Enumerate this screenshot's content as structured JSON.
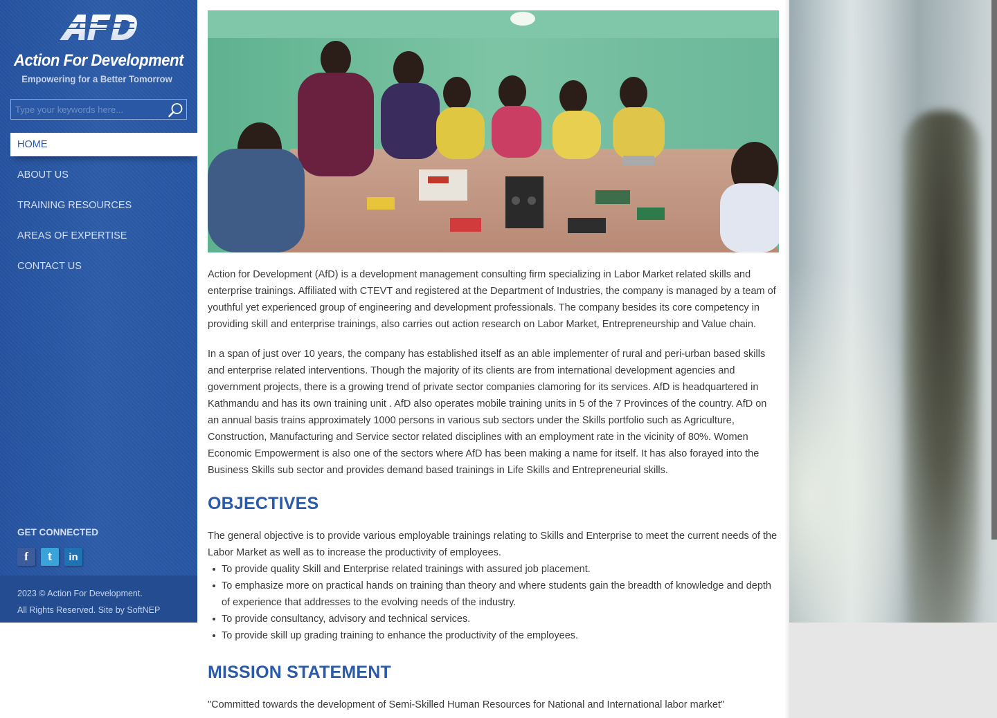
{
  "brand": {
    "logo_text": "AFD",
    "title": "Action For Development",
    "tagline": "Empowering for a Better Tomorrow"
  },
  "search": {
    "placeholder": "Type your keywords here...",
    "icon": "search-icon"
  },
  "nav": {
    "items": [
      {
        "label": "HOME",
        "active": true
      },
      {
        "label": "ABOUT US",
        "active": false
      },
      {
        "label": "TRAINING RESOURCES",
        "active": false
      },
      {
        "label": "AREAS OF EXPERTISE",
        "active": false
      },
      {
        "label": "CONTACT US",
        "active": false
      }
    ]
  },
  "connect": {
    "title": "GET CONNECTED",
    "socials": [
      {
        "name": "facebook",
        "glyph": "f",
        "icon": "facebook-icon",
        "color": "#3b5b9a"
      },
      {
        "name": "twitter",
        "glyph": "t",
        "icon": "twitter-icon",
        "color": "#3aa3d9"
      },
      {
        "name": "linkedin",
        "glyph": "in",
        "icon": "linkedin-icon",
        "color": "#1f73b2"
      }
    ]
  },
  "footer": {
    "line1": "2023 © Action For Development.",
    "line2": "All Rights Reserved. Site by SoftNEP"
  },
  "main": {
    "intro_p1": "Action for Development (AfD) is a development management consulting firm specializing in Labor Market related skills and enterprise trainings. Affiliated with CTEVT and registered at the Department of Industries, the  company is managed by a team of youthful yet experienced group of engineering and development professionals. The company  besides its core competency in providing skill and enterprise trainings, also carries out action research on Labor Market, Entrepreneurship and Value chain.",
    "intro_p2": "In a span of just over 10  years, the company has established itself as an able implementer of rural and peri-urban based skills and enterprise related interventions. Though the majority of its clients are from international development agencies and government projects, there is a growing trend of private sector  companies clamoring for its services. AfD is headquartered in Kathmandu and has its own training unit . AfD also operates mobile  training units in 5 of the 7 Provinces of the country. AfD on an annual basis trains approximately 1000 persons in various sub sectors under the Skills portfolio  such as Agriculture, Construction, Manufacturing and  Service sector related disciplines with an employment rate in the vicinity of  80%. Women Economic Empowerment is also one of the sectors where AfD has been making a name for itself.  It has also forayed into the Business Skills sub sector and provides demand based trainings in Life Skills and Entrepreneurial skills.",
    "objectives_heading": "OBJECTIVES",
    "objectives_intro": "The general objective is to provide various employable trainings relating to Skills and Enterprise to meet the current needs of the Labor Market as well as to increase the productivity of employees.",
    "objectives": [
      "To provide quality Skill and Enterprise related trainings with assured job placement.",
      "To emphasize more on practical hands on training than theory and where students gain the breadth of knowledge and depth of experience that addresses to the evolving needs of the industry.",
      "To provide consultancy, advisory and technical services.",
      "To provide skill up grading training to enhance the productivity of the employees."
    ],
    "mission_heading": "MISSION STATEMENT",
    "mission_text": "\"Committed towards the development of Semi-Skilled Human Resources for National and International labor market\""
  },
  "colors": {
    "sidebar_blue": "#2a58a4",
    "heading_blue": "#2a5aa8",
    "body_text": "#3a3a3a"
  }
}
